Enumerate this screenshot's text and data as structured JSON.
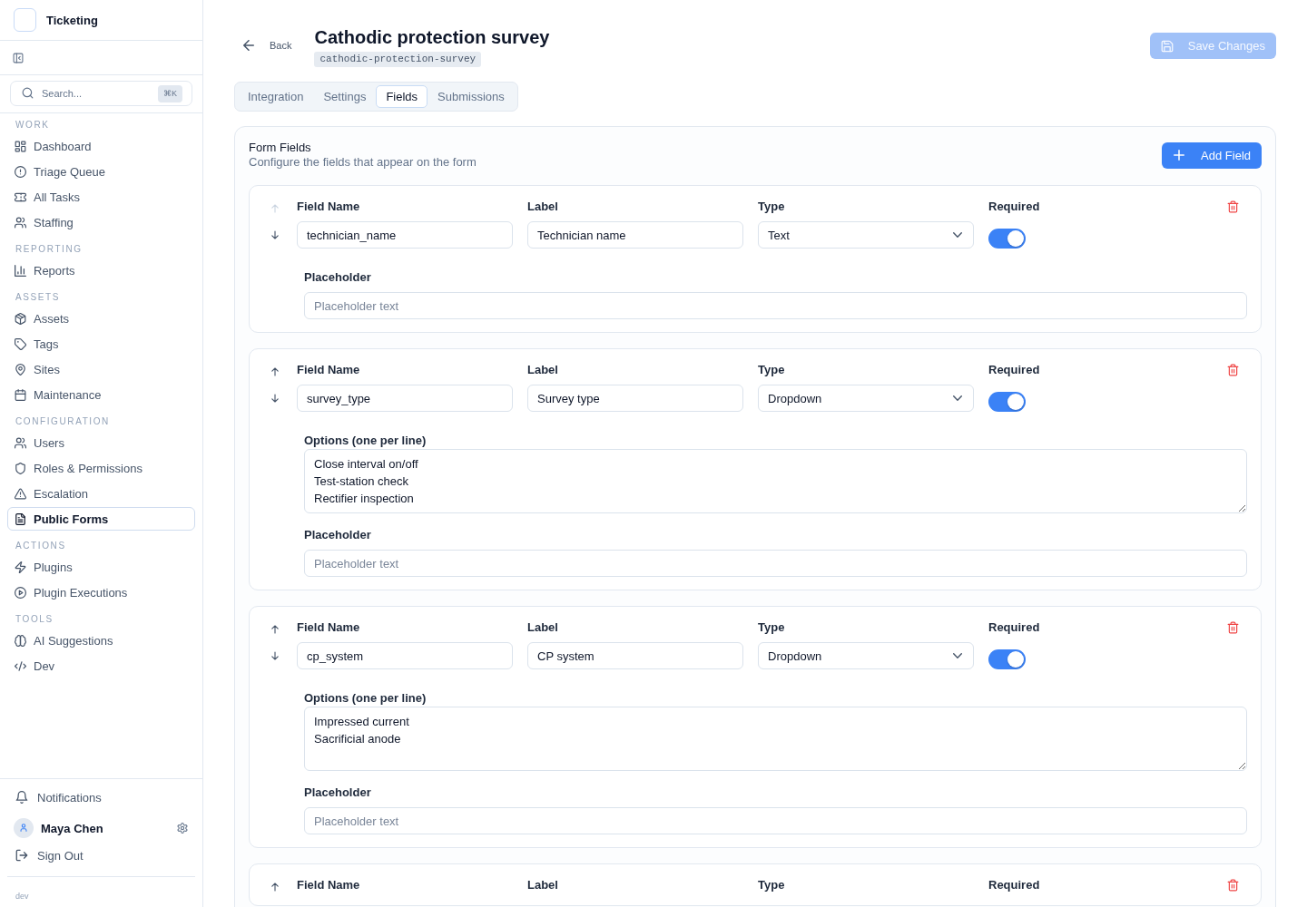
{
  "app": {
    "name": "Ticketing"
  },
  "sidebar": {
    "search": {
      "placeholder": "Search...",
      "shortcut": "⌘K"
    },
    "sections": [
      {
        "title": "WORK",
        "items": [
          {
            "label": "Dashboard",
            "selected": false
          },
          {
            "label": "Triage Queue",
            "selected": false
          },
          {
            "label": "All Tasks",
            "selected": false
          },
          {
            "label": "Staffing",
            "selected": false
          }
        ]
      },
      {
        "title": "REPORTING",
        "items": [
          {
            "label": "Reports",
            "selected": false
          }
        ]
      },
      {
        "title": "ASSETS",
        "items": [
          {
            "label": "Assets",
            "selected": false
          },
          {
            "label": "Tags",
            "selected": false
          },
          {
            "label": "Sites",
            "selected": false
          },
          {
            "label": "Maintenance",
            "selected": false
          }
        ]
      },
      {
        "title": "CONFIGURATION",
        "items": [
          {
            "label": "Users",
            "selected": false
          },
          {
            "label": "Roles & Permissions",
            "selected": false
          },
          {
            "label": "Escalation",
            "selected": false
          },
          {
            "label": "Public Forms",
            "selected": true
          }
        ]
      },
      {
        "title": "ACTIONS",
        "items": [
          {
            "label": "Plugins",
            "selected": false
          },
          {
            "label": "Plugin Executions",
            "selected": false
          }
        ]
      },
      {
        "title": "TOOLS",
        "items": [
          {
            "label": "AI Suggestions",
            "selected": false
          },
          {
            "label": "Dev",
            "selected": false
          }
        ]
      }
    ],
    "footer": {
      "notifications": "Notifications",
      "user_name": "Maya Chen",
      "sign_out": "Sign Out",
      "environment": "dev"
    }
  },
  "header": {
    "back": "Back",
    "title": "Cathodic protection survey",
    "slug": "cathodic-protection-survey",
    "save_button": {
      "label": "Save Changes",
      "disabled": true
    }
  },
  "tabs": [
    {
      "label": "Integration",
      "selected": false
    },
    {
      "label": "Settings",
      "selected": false
    },
    {
      "label": "Fields",
      "selected": true
    },
    {
      "label": "Submissions",
      "selected": false
    }
  ],
  "form_fields": {
    "title": "Form Fields",
    "subtitle": "Configure the fields that appear on the form",
    "add_button": "Add Field",
    "fields": [
      {
        "kind": "text",
        "move_up_disabled": true,
        "name_heading": "Field Name",
        "name": "technician_name",
        "label_heading": "Label",
        "label": "Technician name",
        "type_heading": "Type",
        "type": "Text",
        "required_heading": "Required",
        "required": true,
        "placeholder_heading": "Placeholder",
        "placeholder": "Placeholder text"
      },
      {
        "kind": "dropdown",
        "move_up_disabled": false,
        "name_heading": "Field Name",
        "name": "survey_type",
        "label_heading": "Label",
        "label": "Survey type",
        "type_heading": "Type",
        "type": "Dropdown",
        "required_heading": "Required",
        "required": true,
        "options_heading": "Options (one per line)",
        "options": [
          "Close interval on/off",
          "Test-station check",
          "Rectifier inspection"
        ],
        "placeholder_heading": "Placeholder",
        "placeholder": "Placeholder text"
      },
      {
        "kind": "dropdown",
        "move_up_disabled": false,
        "name_heading": "Field Name",
        "name": "cp_system",
        "label_heading": "Label",
        "label": "CP system",
        "type_heading": "Type",
        "type": "Dropdown",
        "required_heading": "Required",
        "required": true,
        "options_heading": "Options (one per line)",
        "options": [
          "Impressed current",
          "Sacrificial anode"
        ],
        "placeholder_heading": "Placeholder",
        "placeholder": "Placeholder text"
      },
      {
        "kind": "text",
        "move_up_disabled": false,
        "name_heading": "Field Name",
        "label_heading": "Label",
        "type_heading": "Type",
        "required_heading": "Required"
      }
    ]
  }
}
